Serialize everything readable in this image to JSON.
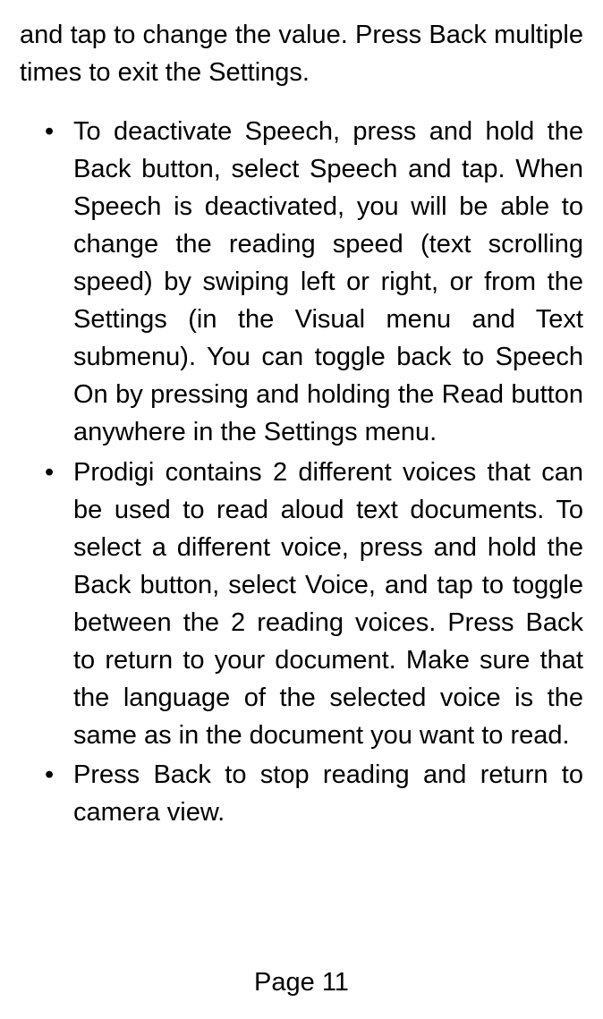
{
  "intro": "and tap to change the value. Press Back multiple times to exit the Settings.",
  "bullets": {
    "item1": "To deactivate Speech, press and hold the Back button, select Speech and tap. When Speech is deactivated, you will be able to change the reading speed (text scrolling speed) by swiping left or right, or from the Settings (in the Visual menu and Text submenu). You can toggle back to Speech On by pressing and holding the Read button anywhere in the Settings menu.",
    "item2": "Prodigi contains 2 different voices that can be used to read aloud text documents. To select a different voice, press and hold the Back button, select Voice, and tap to toggle between the 2 reading voices. Press Back to return to your document. Make sure that the language of the selected voice is the same as in the document you want to read.",
    "item3": "Press Back to stop reading and return to camera view."
  },
  "pageNumber": "Page 11"
}
